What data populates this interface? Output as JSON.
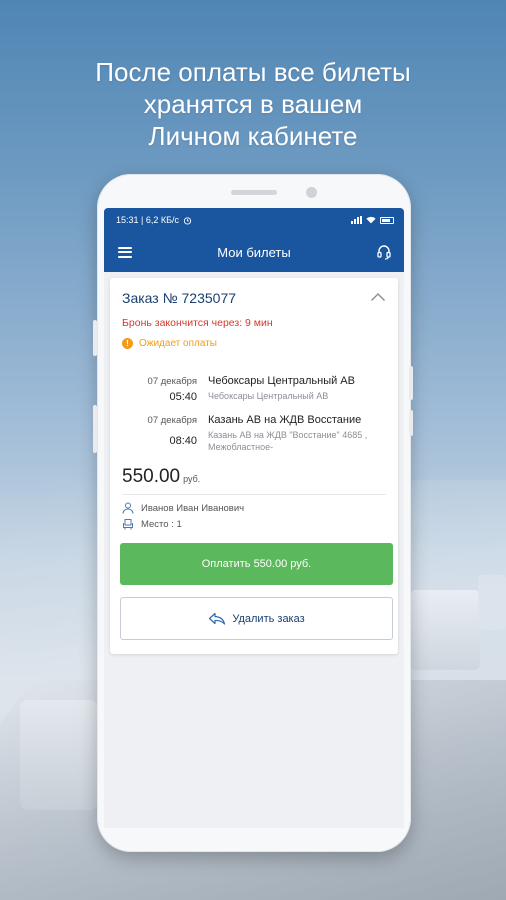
{
  "headline": {
    "line1": "После оплаты все билеты",
    "line2": "хранятся в вашем",
    "line3": "Личном кабинете"
  },
  "statusbar": {
    "time": "15:31 | 6,2 КБ/с",
    "icons": [
      "alarm-icon",
      "signal-icon",
      "wifi-icon",
      "battery-icon"
    ]
  },
  "toolbar": {
    "title": "Мои билеты",
    "menu_icon": "menu-icon",
    "support_icon": "headset-icon"
  },
  "order": {
    "title": "Заказ № 7235077",
    "reserve_text": "Бронь закончится через: 9 мин",
    "status_text": "Ожидает оплаты",
    "departure": {
      "date": "07 декабря",
      "time": "05:40",
      "station": "Чебоксары Центральный АВ",
      "station_sub": "Чебоксары Центральный АВ"
    },
    "arrival": {
      "date": "07 декабря",
      "time": "08:40",
      "station": "Казань АВ на ЖДВ Восстание",
      "station_sub": "Казань АВ на ЖДВ \"Восстание\" 4685 , Межобластное-"
    },
    "price": "550.00",
    "price_unit": "руб.",
    "passenger_name": "Иванов Иван Иванович",
    "seat": "Место : 1",
    "pay_button": "Оплатить 550.00 руб.",
    "delete_button": "Удалить заказ"
  },
  "colors": {
    "brand": "#1a56a0",
    "alert": "#d33a2c",
    "pending": "#f29d17",
    "pay": "#5cb85c"
  }
}
